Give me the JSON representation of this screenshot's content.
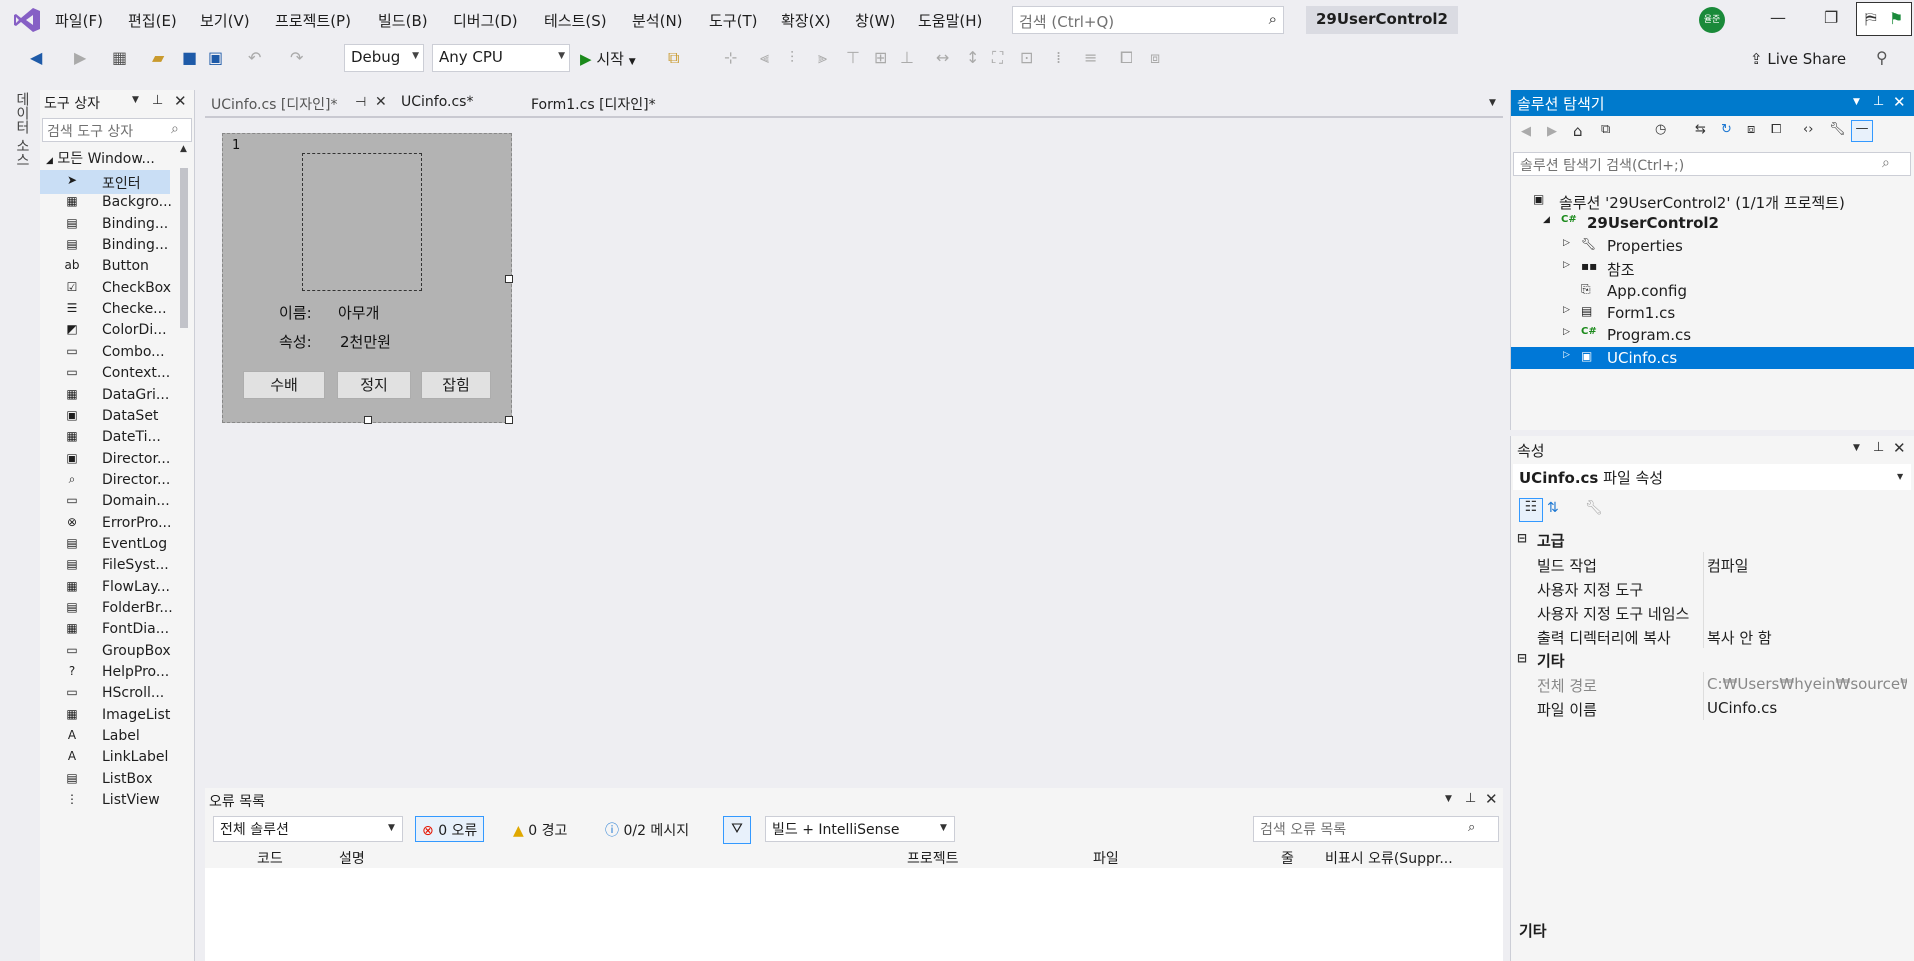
{
  "menubar": {
    "items": [
      "파일(F)",
      "편집(E)",
      "보기(V)",
      "프로젝트(P)",
      "빌드(B)",
      "디버그(D)",
      "테스트(S)",
      "분석(N)",
      "도구(T)",
      "확장(X)",
      "창(W)",
      "도움말(H)"
    ],
    "search_placeholder": "검색 (Ctrl+Q)",
    "solution_name": "29UserControl2",
    "avatar_text": "율준"
  },
  "toolbar": {
    "config": "Debug",
    "platform": "Any CPU",
    "start_label": "시작",
    "liveshare_label": "Live Share"
  },
  "leftstrip": {
    "label": "데이터 소스"
  },
  "toolbox": {
    "title": "도구 상자",
    "search_placeholder": "검색 도구 상자",
    "group": "모든 Window...",
    "items": [
      {
        "label": "포인터",
        "icon": "pointer-icon"
      },
      {
        "label": "Backgro...",
        "icon": "backgroundworker-icon"
      },
      {
        "label": "Binding...",
        "icon": "bindingnavigator-icon"
      },
      {
        "label": "Binding...",
        "icon": "bindingsource-icon"
      },
      {
        "label": "Button",
        "icon": "button-icon"
      },
      {
        "label": "CheckBox",
        "icon": "checkbox-icon"
      },
      {
        "label": "Checke...",
        "icon": "checkedlistbox-icon"
      },
      {
        "label": "ColorDi...",
        "icon": "colordialog-icon"
      },
      {
        "label": "Combo...",
        "icon": "combobox-icon"
      },
      {
        "label": "Context...",
        "icon": "contextmenu-icon"
      },
      {
        "label": "DataGri...",
        "icon": "datagridview-icon"
      },
      {
        "label": "DataSet",
        "icon": "dataset-icon"
      },
      {
        "label": "DateTi...",
        "icon": "datetimepicker-icon"
      },
      {
        "label": "Director...",
        "icon": "directoryentry-icon"
      },
      {
        "label": "Director...",
        "icon": "directorysearcher-icon"
      },
      {
        "label": "Domain...",
        "icon": "domainupdown-icon"
      },
      {
        "label": "ErrorPro...",
        "icon": "errorprovider-icon"
      },
      {
        "label": "EventLog",
        "icon": "eventlog-icon"
      },
      {
        "label": "FileSyst...",
        "icon": "filesystemwatcher-icon"
      },
      {
        "label": "FlowLay...",
        "icon": "flowlayoutpanel-icon"
      },
      {
        "label": "FolderBr...",
        "icon": "folderbrowser-icon"
      },
      {
        "label": "FontDia...",
        "icon": "fontdialog-icon"
      },
      {
        "label": "GroupBox",
        "icon": "groupbox-icon"
      },
      {
        "label": "HelpPro...",
        "icon": "helpprovider-icon"
      },
      {
        "label": "HScroll...",
        "icon": "hscrollbar-icon"
      },
      {
        "label": "ImageList",
        "icon": "imagelist-icon"
      },
      {
        "label": "Label",
        "icon": "label-icon"
      },
      {
        "label": "LinkLabel",
        "icon": "linklabel-icon"
      },
      {
        "label": "ListBox",
        "icon": "listbox-icon"
      },
      {
        "label": "ListView",
        "icon": "listview-icon"
      }
    ]
  },
  "doctabs": [
    {
      "label": "UCinfo.cs [디자인]*",
      "active": true
    },
    {
      "label": "UCinfo.cs*",
      "active": false
    },
    {
      "label": "Form1.cs [디자인]*",
      "active": false
    }
  ],
  "usercontrol": {
    "corner_label": "1",
    "name_label": "이름:",
    "name_value": "아무개",
    "attr_label": "속성:",
    "attr_value": "2천만원",
    "buttons": [
      "수배",
      "정지",
      "잡힘"
    ]
  },
  "errorlist": {
    "title": "오류 목록",
    "scope": "전체 솔루션",
    "errors": "0 오류",
    "warnings": "0 경고",
    "messages": "0/2 메시지",
    "build_filter": "빌드 + IntelliSense",
    "search_placeholder": "검색 오류 목록",
    "columns": [
      "코드",
      "설명",
      "프로젝트",
      "파일",
      "줄",
      "비표시 오류(Suppr..."
    ]
  },
  "solution_explorer": {
    "title": "솔루션 탐색기",
    "search_placeholder": "솔루션 탐색기 검색(Ctrl+;)",
    "nodes": [
      {
        "label": "솔루션 '29UserControl2' (1/1개 프로젝트)",
        "icon": "solution-icon",
        "bold": false
      },
      {
        "label": "29UserControl2",
        "icon": "csharp-project-icon",
        "bold": true
      },
      {
        "label": "Properties",
        "icon": "wrench-icon",
        "bold": false
      },
      {
        "label": "참조",
        "icon": "references-icon",
        "bold": false
      },
      {
        "label": "App.config",
        "icon": "config-file-icon",
        "bold": false
      },
      {
        "label": "Form1.cs",
        "icon": "form-icon",
        "bold": false
      },
      {
        "label": "Program.cs",
        "icon": "csharp-file-icon",
        "bold": false
      },
      {
        "label": "UCinfo.cs",
        "icon": "usercontrol-icon",
        "bold": false
      }
    ]
  },
  "properties": {
    "title": "속성",
    "object": "UCinfo.cs",
    "object_suffix": "파일 속성",
    "cat_advanced": "고급",
    "advanced": [
      {
        "name": "빌드 작업",
        "value": "컴파일"
      },
      {
        "name": "사용자 지정 도구",
        "value": ""
      },
      {
        "name": "사용자 지정 도구 네임스",
        "value": ""
      },
      {
        "name": "출력 디렉터리에 복사",
        "value": "복사 안 함"
      }
    ],
    "cat_misc": "기타",
    "misc": [
      {
        "name": "전체 경로",
        "value": "C:₩Users₩hyein₩source₩repo"
      },
      {
        "name": "파일 이름",
        "value": "UCinfo.cs"
      }
    ],
    "description": "기타"
  },
  "colors": {
    "accent": "#007acc",
    "selection": "#0078d7",
    "vs_purple": "#865fc5"
  }
}
